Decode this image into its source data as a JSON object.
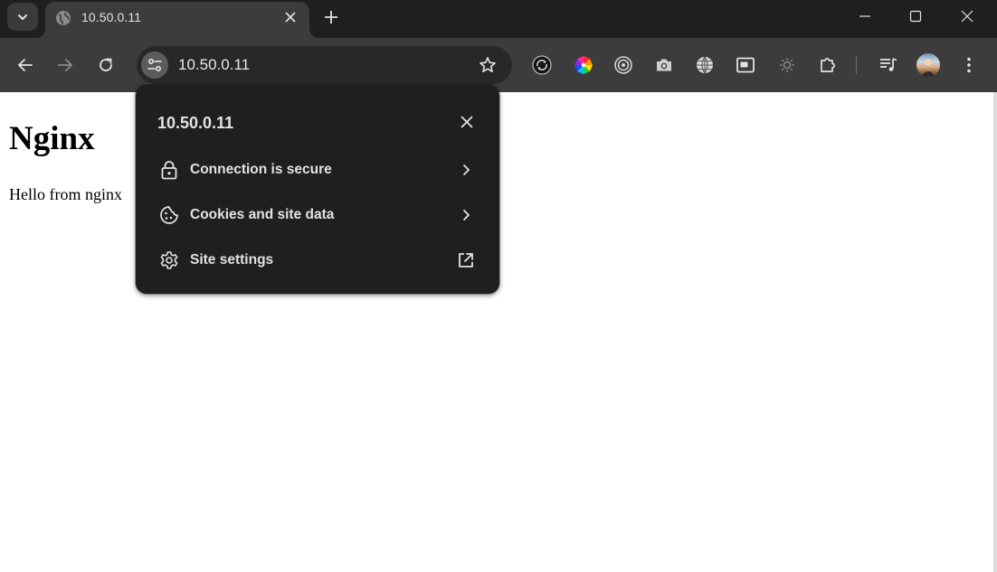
{
  "browser": {
    "tab": {
      "title": "10.50.0.11"
    },
    "omnibox": {
      "url": "10.50.0.11"
    }
  },
  "page": {
    "heading": "Nginx",
    "body_text": "Hello from nginx"
  },
  "site_info_popup": {
    "title": "10.50.0.11",
    "items": [
      {
        "label": "Connection is secure",
        "icon": "lock-icon",
        "end_icon": "chevron-right-icon"
      },
      {
        "label": "Cookies and site data",
        "icon": "cookie-icon",
        "end_icon": "chevron-right-icon"
      },
      {
        "label": "Site settings",
        "icon": "gear-icon",
        "end_icon": "open-in-new-icon"
      }
    ]
  },
  "colors": {
    "tabstrip_bg": "#1f1f1f",
    "toolbar_bg": "#3c3c3c",
    "popup_bg": "#1f1f1f",
    "text_light": "#e3e3e3"
  }
}
